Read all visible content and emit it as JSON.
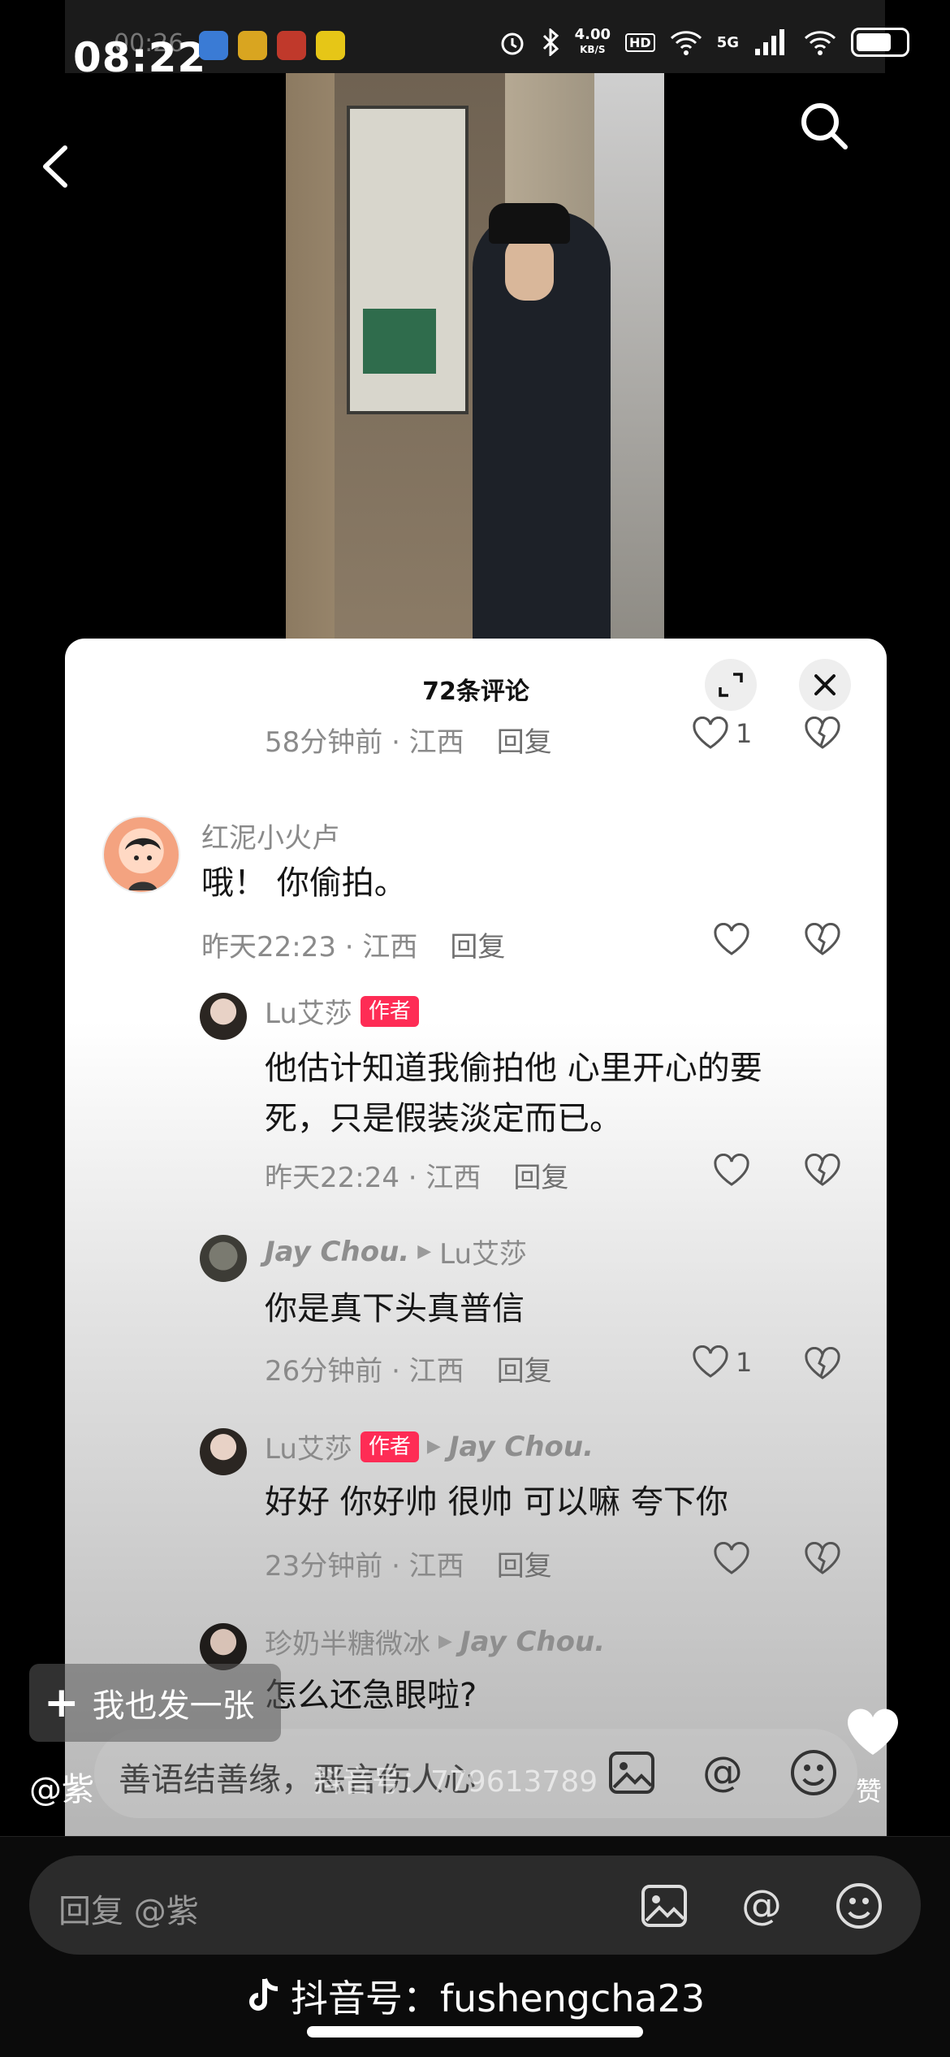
{
  "status_bar": {
    "time": "08:22",
    "time_ghost": "00:26",
    "net_speed": "4.00",
    "net_unit": "KB/S",
    "hd": "HD",
    "network": "5G"
  },
  "panel": {
    "title": "72条评论"
  },
  "comments": [
    {
      "meta_time": "58分钟前 · 江西",
      "reply": "回复",
      "likes": "1"
    },
    {
      "name": "红泥小火卢",
      "text": "哦！ 你偷拍。",
      "meta_time": "昨天22:23 · 江西",
      "reply": "回复"
    },
    {
      "name": "Lu艾莎",
      "tag": "作者",
      "text": "他估计知道我偷拍他 心里开心的要死，只是假装淡定而已。",
      "meta_time": "昨天22:24 · 江西",
      "reply": "回复"
    },
    {
      "name": "Jay Chou.",
      "reply_to": "Lu艾莎",
      "text": "你是真下头真普信",
      "meta_time": "26分钟前 · 江西",
      "reply": "回复",
      "likes": "1"
    },
    {
      "name": "Lu艾莎",
      "tag": "作者",
      "reply_to": "Jay Chou.",
      "text": "好好 你好帅 很帅 可以嘛 夸下你",
      "meta_time": "23分钟前 · 江西",
      "reply": "回复"
    },
    {
      "name": "珍奶半糖微冰",
      "reply_to": "Jay Chou.",
      "text": "怎么还急眼啦?"
    }
  ],
  "overlay": {
    "post_label": "我也发一张",
    "at_user": "@紫",
    "input_placeholder": "善语结善缘，恶言伤人心",
    "watermark": "抖音号：779613789",
    "like_label": "赞"
  },
  "bottom": {
    "reply_placeholder": "回复 @紫",
    "douyin_id": "抖音号：fushengcha23"
  }
}
